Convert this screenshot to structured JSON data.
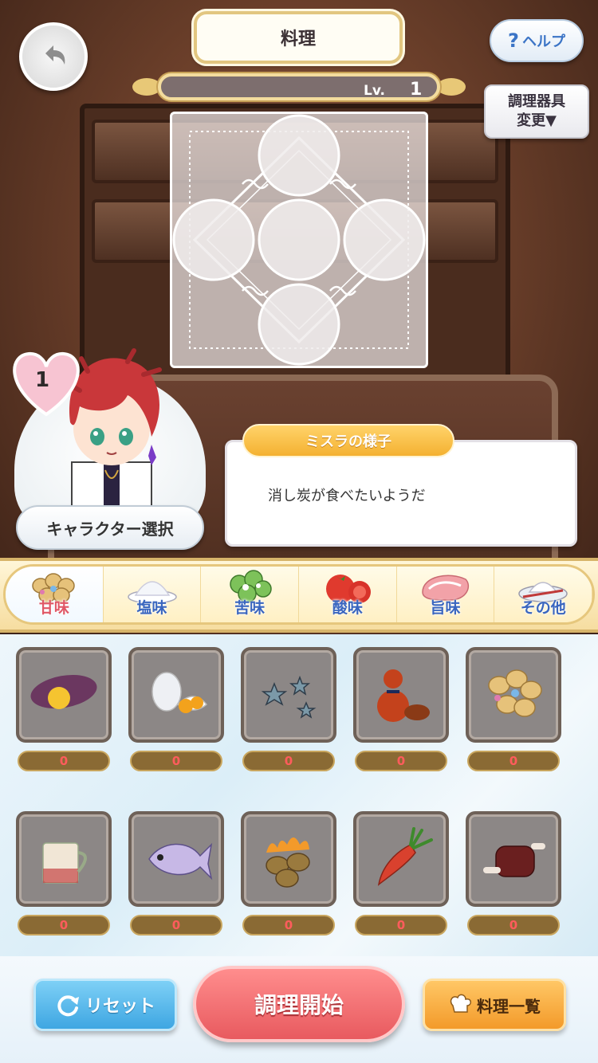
{
  "header": {
    "title": "料理",
    "level_label": "Lv.",
    "level_value": "1",
    "help_label": "ヘルプ",
    "help_icon": "?",
    "tool_line1": "調理器具",
    "tool_line2": "変更▼"
  },
  "character": {
    "affection": "1",
    "select_label": "キャラクター選択"
  },
  "status": {
    "title": "ミスラの様子",
    "message": "消し炭が食べたいようだ"
  },
  "tabs": [
    {
      "label": "甘味",
      "icon": "sweets-icon",
      "active": true
    },
    {
      "label": "塩味",
      "icon": "salt-icon",
      "active": false
    },
    {
      "label": "苦味",
      "icon": "herbs-icon",
      "active": false
    },
    {
      "label": "酸味",
      "icon": "tomato-icon",
      "active": false
    },
    {
      "label": "旨味",
      "icon": "meat-icon",
      "active": false
    },
    {
      "label": "その他",
      "icon": "other-icon",
      "active": false
    }
  ],
  "ingredients": [
    {
      "icon": "sweet-potato-icon",
      "count": "0"
    },
    {
      "icon": "egg-icon",
      "count": "0"
    },
    {
      "icon": "star-candy-icon",
      "count": "0"
    },
    {
      "icon": "gourd-icon",
      "count": "0"
    },
    {
      "icon": "nuts-icon",
      "count": "0"
    },
    {
      "icon": "milk-mug-icon",
      "count": "0"
    },
    {
      "icon": "fish-icon",
      "count": "0"
    },
    {
      "icon": "burning-potato-icon",
      "count": "0"
    },
    {
      "icon": "carrot-icon",
      "count": "0"
    },
    {
      "icon": "bone-meat-icon",
      "count": "0"
    }
  ],
  "footer": {
    "reset_label": "リセット",
    "start_label": "調理開始",
    "list_label": "料理一覧"
  },
  "colors": {
    "active_tab": "#e05866",
    "tab_text": "#3a66bf",
    "count_text": "#ff5c5c",
    "start_button": "#e85a5f"
  }
}
